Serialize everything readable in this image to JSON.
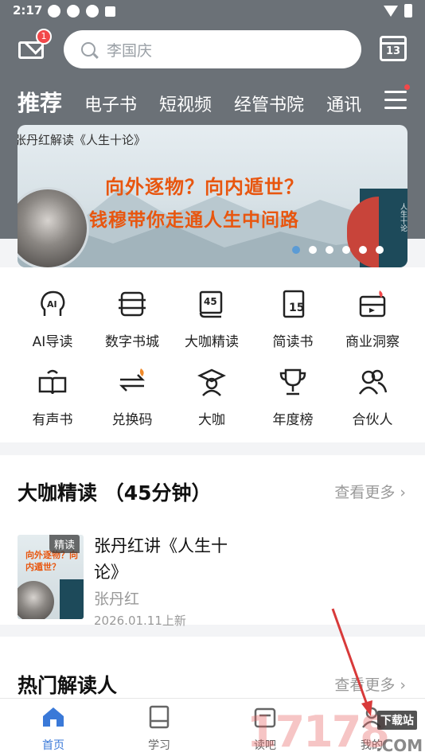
{
  "status_bar": {
    "time": "2:17"
  },
  "header": {
    "mail_badge": "1",
    "search_placeholder": "李国庆",
    "calendar_day": "13"
  },
  "tabs": [
    {
      "label": "推荐",
      "active": true
    },
    {
      "label": "电子书"
    },
    {
      "label": "短视频"
    },
    {
      "label": "经管书院"
    },
    {
      "label": "通讯"
    }
  ],
  "banner": {
    "caption": "张丹红解读《人生十论》",
    "headline": "向外逐物？向内遁世？",
    "subline": "钱穆带你走通人生中间路",
    "cover_title": "人生十论",
    "dots_total": 6,
    "dots_active": 0
  },
  "grid": [
    {
      "label": "AI导读",
      "icon": "ai-head-icon"
    },
    {
      "label": "数字书城",
      "icon": "bookshelf-icon"
    },
    {
      "label": "大咖精读",
      "icon": "45min-book-icon"
    },
    {
      "label": "简读书",
      "icon": "15min-book-icon"
    },
    {
      "label": "商业洞察",
      "icon": "insight-screen-icon"
    },
    {
      "label": "有声书",
      "icon": "audio-book-icon"
    },
    {
      "label": "兑换码",
      "icon": "exchange-icon"
    },
    {
      "label": "大咖",
      "icon": "graduate-icon"
    },
    {
      "label": "年度榜",
      "icon": "trophy-icon"
    },
    {
      "label": "合伙人",
      "icon": "partners-icon"
    }
  ],
  "section_featured": {
    "title": "大咖精读 （45分钟）",
    "more": "查看更多",
    "book": {
      "tag": "精读",
      "title": "张丹红讲《人生十论》",
      "author": "张丹红",
      "date": "2026.01.11上新",
      "cover_headline": "向外逐物？向内遁世？",
      "cover_sub": "钱穆带你走通人生中间路"
    }
  },
  "section_hot": {
    "title": "热门解读人",
    "more": "查看更多"
  },
  "bottom_nav": [
    {
      "label": "首页",
      "active": true,
      "icon": "home-icon"
    },
    {
      "label": "学习",
      "icon": "book-icon"
    },
    {
      "label": "读吧",
      "icon": "read-icon"
    },
    {
      "label": "我的",
      "icon": "profile-icon"
    }
  ],
  "watermark": {
    "text": "17178",
    "tag": "下载站",
    "com": ".COM"
  },
  "colors": {
    "header": "#6b7177",
    "accent": "#3a79d8",
    "banner_text": "#e8560f",
    "badge": "#f2484a"
  }
}
